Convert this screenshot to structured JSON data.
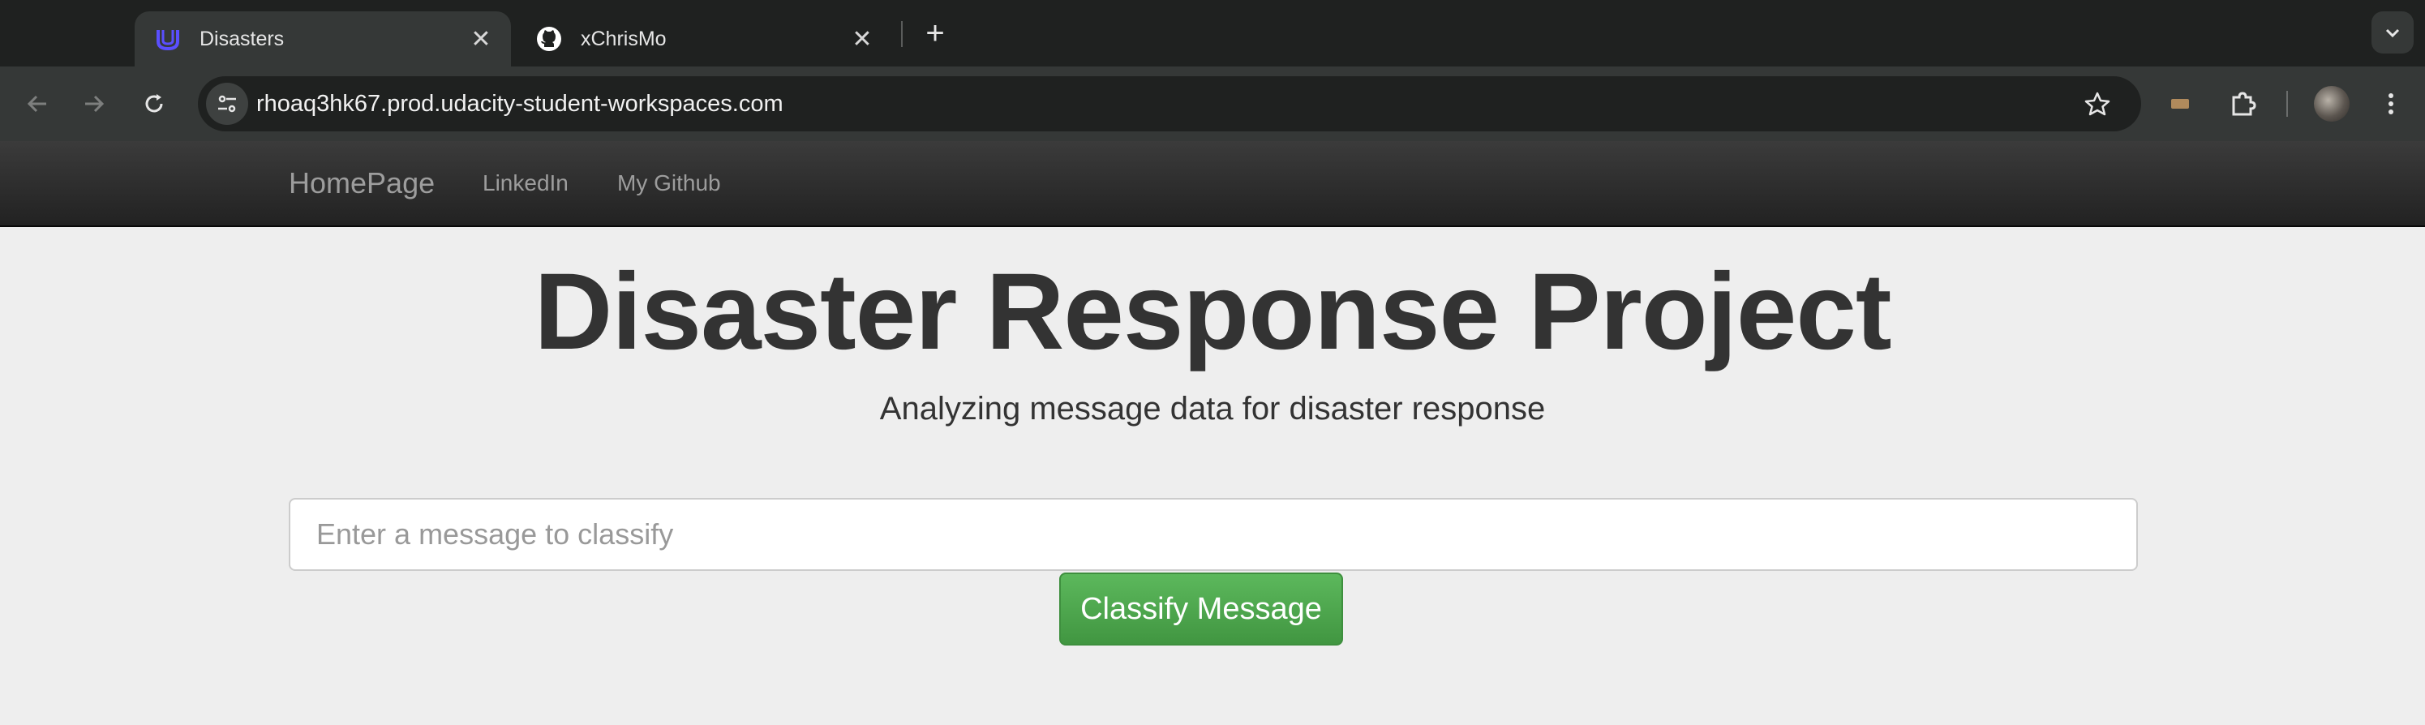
{
  "browser": {
    "tabs": [
      {
        "title": "Disasters",
        "favicon": "udacity-icon",
        "active": true
      },
      {
        "title": "xChrisMo",
        "favicon": "github-icon",
        "active": false
      }
    ],
    "address_bar": {
      "url": "rhoaq3hk67.prod.udacity-student-workspaces.com"
    },
    "colors": {
      "tabbar": "#1f2120",
      "toolbar": "#353837",
      "active_tab": "#353837"
    }
  },
  "navbar": {
    "brand": "HomePage",
    "links": [
      {
        "label": "LinkedIn"
      },
      {
        "label": "My Github"
      }
    ]
  },
  "hero": {
    "title": "Disaster Response Project",
    "subtitle": "Analyzing message data for disaster response"
  },
  "form": {
    "message_placeholder": "Enter a message to classify",
    "submit_label": "Classify Message",
    "button_color": "#5cb85c"
  }
}
